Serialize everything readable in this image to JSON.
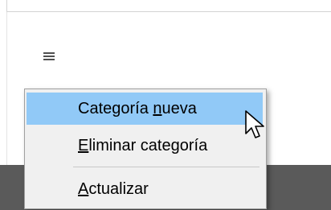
{
  "context_menu": {
    "items": [
      {
        "before": "Categoría ",
        "accel": "n",
        "after": "ueva",
        "hovered": true
      },
      {
        "before": "",
        "accel": "E",
        "after": "liminar categoría",
        "hovered": false
      },
      {
        "before": "",
        "accel": "A",
        "after": "ctualizar",
        "hovered": false
      }
    ]
  },
  "icons": {
    "menu": "hamburger-menu-icon",
    "cursor": "mouse-pointer-icon"
  },
  "colors": {
    "menu_background": "#f0f0f0",
    "hover_highlight": "#91c9f7",
    "bottom_strip": "#5a5a5a"
  }
}
